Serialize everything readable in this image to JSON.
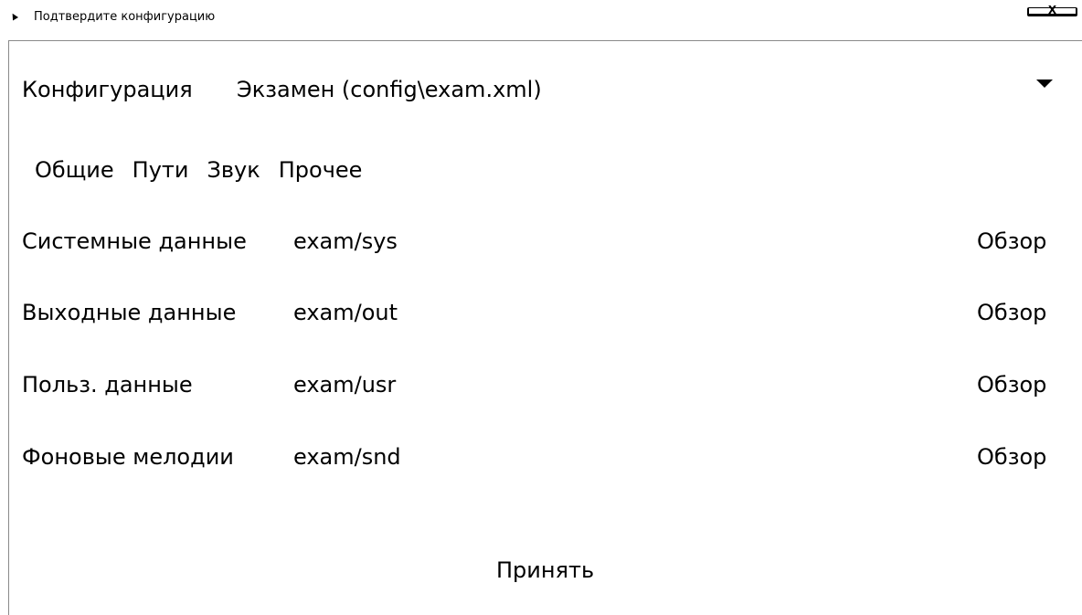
{
  "window": {
    "title": "Подтвердите конфигурацию",
    "app_icon": "pin-icon",
    "close_label": "X"
  },
  "config": {
    "label": "Конфигурация",
    "selected": "Экзамен (config\\exam.xml)",
    "dropdown_icon": "chevron-down-icon"
  },
  "tabs": [
    {
      "label": "Общие"
    },
    {
      "label": "Пути"
    },
    {
      "label": "Звук"
    },
    {
      "label": "Прочее"
    }
  ],
  "paths": [
    {
      "label": "Системные данные",
      "value": "exam/sys",
      "browse": "Обзор"
    },
    {
      "label": "Выходные данные",
      "value": "exam/out",
      "browse": "Обзор"
    },
    {
      "label": "Польз. данные",
      "value": "exam/usr",
      "browse": "Обзор"
    },
    {
      "label": "Фоновые мелодии",
      "value": "exam/snd",
      "browse": "Обзор"
    }
  ],
  "accept_label": "Принять"
}
